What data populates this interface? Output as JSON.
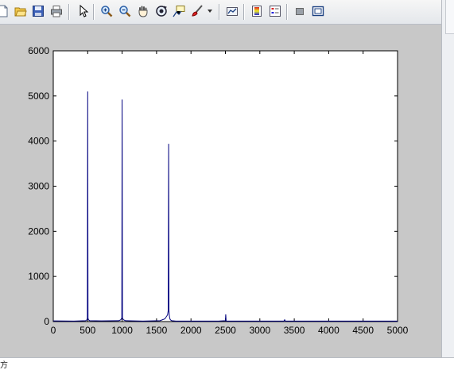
{
  "toolbar": {
    "buttons": [
      {
        "name": "new-figure",
        "icon": "new-file-icon"
      },
      {
        "name": "open-file",
        "icon": "folder-open-icon"
      },
      {
        "name": "save-figure",
        "icon": "save-disk-icon"
      },
      {
        "name": "print-figure",
        "icon": "printer-icon"
      },
      {
        "name": "edit-plot",
        "icon": "arrow-cursor-icon"
      },
      {
        "name": "zoom-in",
        "icon": "zoom-in-icon"
      },
      {
        "name": "zoom-out",
        "icon": "zoom-out-icon"
      },
      {
        "name": "pan",
        "icon": "hand-icon"
      },
      {
        "name": "rotate-3d",
        "icon": "rotate-icon"
      },
      {
        "name": "data-cursor",
        "icon": "data-cursor-icon"
      },
      {
        "name": "brush",
        "icon": "brush-icon"
      },
      {
        "name": "link-plot",
        "icon": "link-icon"
      },
      {
        "name": "insert-colorbar",
        "icon": "colorbar-icon"
      },
      {
        "name": "insert-legend",
        "icon": "legend-icon"
      },
      {
        "name": "hide-plot-tools",
        "icon": "hide-tools-icon"
      },
      {
        "name": "show-plot-tools",
        "icon": "show-tools-icon"
      }
    ]
  },
  "status": {
    "corner_text": "方"
  },
  "colors": {
    "figure_background": "#c8c8c8",
    "axes_background": "#ffffff",
    "line": "#00007f"
  },
  "chart_data": {
    "type": "line",
    "title": "",
    "xlabel": "",
    "ylabel": "",
    "xlim": [
      0,
      5000
    ],
    "ylim": [
      0,
      6000
    ],
    "x_ticks": [
      0,
      500,
      1000,
      1500,
      2000,
      2500,
      3000,
      3500,
      4000,
      4500,
      5000
    ],
    "y_ticks": [
      0,
      1000,
      2000,
      3000,
      4000,
      5000,
      6000
    ],
    "grid": false,
    "series": [
      {
        "x": [
          0,
          300,
          470,
          490,
          495,
          500,
          505,
          510,
          530,
          700,
          950,
          980,
          995,
          1000,
          1005,
          1020,
          1050,
          1300,
          1550,
          1620,
          1660,
          1670,
          1675,
          1680,
          1685,
          1690,
          1700,
          1720,
          1780,
          2000,
          2400,
          2500,
          2505,
          2510,
          2520,
          3000,
          3350,
          3360,
          3370,
          4000,
          5000
        ],
        "y": [
          15,
          10,
          20,
          40,
          80,
          5100,
          80,
          40,
          20,
          15,
          20,
          40,
          80,
          4920,
          80,
          40,
          20,
          10,
          20,
          60,
          150,
          250,
          3940,
          250,
          150,
          80,
          40,
          20,
          10,
          10,
          10,
          20,
          160,
          20,
          10,
          10,
          10,
          40,
          10,
          10,
          10
        ]
      }
    ]
  }
}
